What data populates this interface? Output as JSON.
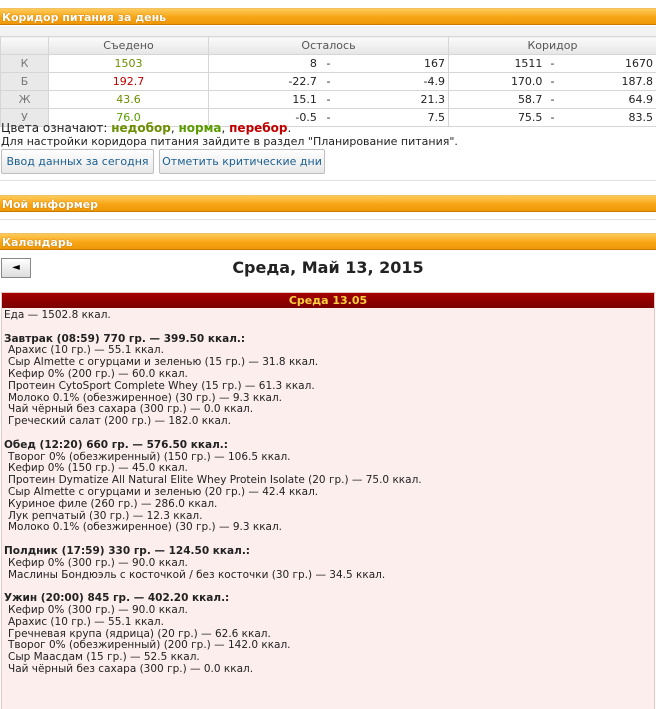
{
  "corridor": {
    "title": "Коридор питания за день",
    "headers": {
      "eaten": "Съедено",
      "left": "Осталось",
      "corridor": "Коридор"
    },
    "rows": [
      {
        "label": "К",
        "eaten": "1503",
        "eaten_status": "low",
        "left_min": "8",
        "left_max": "167",
        "cor_min": "1511",
        "cor_max": "1670"
      },
      {
        "label": "Б",
        "eaten": "192.7",
        "eaten_status": "high",
        "left_min": "-22.7",
        "left_max": "-4.9",
        "cor_min": "170.0",
        "cor_max": "187.8"
      },
      {
        "label": "Ж",
        "eaten": "43.6",
        "eaten_status": "low",
        "left_min": "15.1",
        "left_max": "21.3",
        "cor_min": "58.7",
        "cor_max": "64.9"
      },
      {
        "label": "У",
        "eaten": "76.0",
        "eaten_status": "norm",
        "left_min": "-0.5",
        "left_max": "7.5",
        "cor_min": "75.5",
        "cor_max": "83.5"
      }
    ],
    "dash": "-",
    "legend_prefix": "Цвета означают: ",
    "legend_low": "недобор",
    "legend_norm": "норма",
    "legend_high": "перебор",
    "legend_sep": ", ",
    "legend_end": ".",
    "note": "Для настройки коридора питания зайдите в раздел \"Планирование питания\".",
    "btn_today": "Ввод данных за сегодня",
    "btn_critical": "Отметить критические дни",
    "colors": {
      "low": "#6b8e00",
      "norm": "#5a9c00",
      "high": "#c00000"
    }
  },
  "informer": {
    "title": "Мой информер"
  },
  "calendar": {
    "title": "Календарь",
    "prev_icon": "◄",
    "date_title": "Среда, Май 13, 2015",
    "day_header": "Среда 13.05",
    "total": "Еда — 1502.8 ккал.",
    "meals": [
      {
        "title": "Завтрак (08:59) 770 гр. — 399.50 ккал.:",
        "items": [
          "Арахис (10 гр.) — 55.1 ккал.",
          "Сыр Almette с огурцами и зеленью (15 гр.) — 31.8 ккал.",
          "Кефир 0% (200 гр.) — 60.0 ккал.",
          "Протеин CytoSport Complete Whey (15 гр.) — 61.3 ккал.",
          "Молоко 0.1% (обезжиренное) (30 гр.) — 9.3 ккал.",
          "Чай чёрный без сахара (300 гр.) — 0.0 ккал.",
          "Греческий салат (200 гр.) — 182.0 ккал."
        ]
      },
      {
        "title": "Обед (12:20) 660 гр. — 576.50 ккал.:",
        "items": [
          "Творог 0% (обезжиренный) (150 гр.) — 106.5 ккал.",
          "Кефир 0% (150 гр.) — 45.0 ккал.",
          "Протеин Dymatize All Natural Elite Whey Protein Isolate (20 гр.) — 75.0 ккал.",
          "Сыр Almette с огурцами и зеленью (20 гр.) — 42.4 ккал.",
          "Куриное филе (260 гр.) — 286.0 ккал.",
          "Лук репчатый (30 гр.) — 12.3 ккал.",
          "Молоко 0.1% (обезжиренное) (30 гр.) — 9.3 ккал."
        ]
      },
      {
        "title": "Полдник (17:59) 330 гр. — 124.50 ккал.:",
        "items": [
          "Кефир 0% (300 гр.) — 90.0 ккал.",
          "Маслины Бондюэль с косточкой / без косточки (30 гр.) — 34.5 ккал."
        ]
      },
      {
        "title": "Ужин (20:00) 845 гр. — 402.20 ккал.:",
        "items": [
          "Кефир 0% (300 гр.) — 90.0 ккал.",
          "Арахис (10 гр.) — 55.1 ккал.",
          "Гречневая крупа (ядрица) (20 гр.) — 62.6 ккал.",
          "Творог 0% (обезжиренный) (200 гр.) — 142.0 ккал.",
          "Сыр Маасдам (15 гр.) — 52.5 ккал.",
          "Чай чёрный без сахара (300 гр.) — 0.0 ккал."
        ]
      }
    ]
  }
}
